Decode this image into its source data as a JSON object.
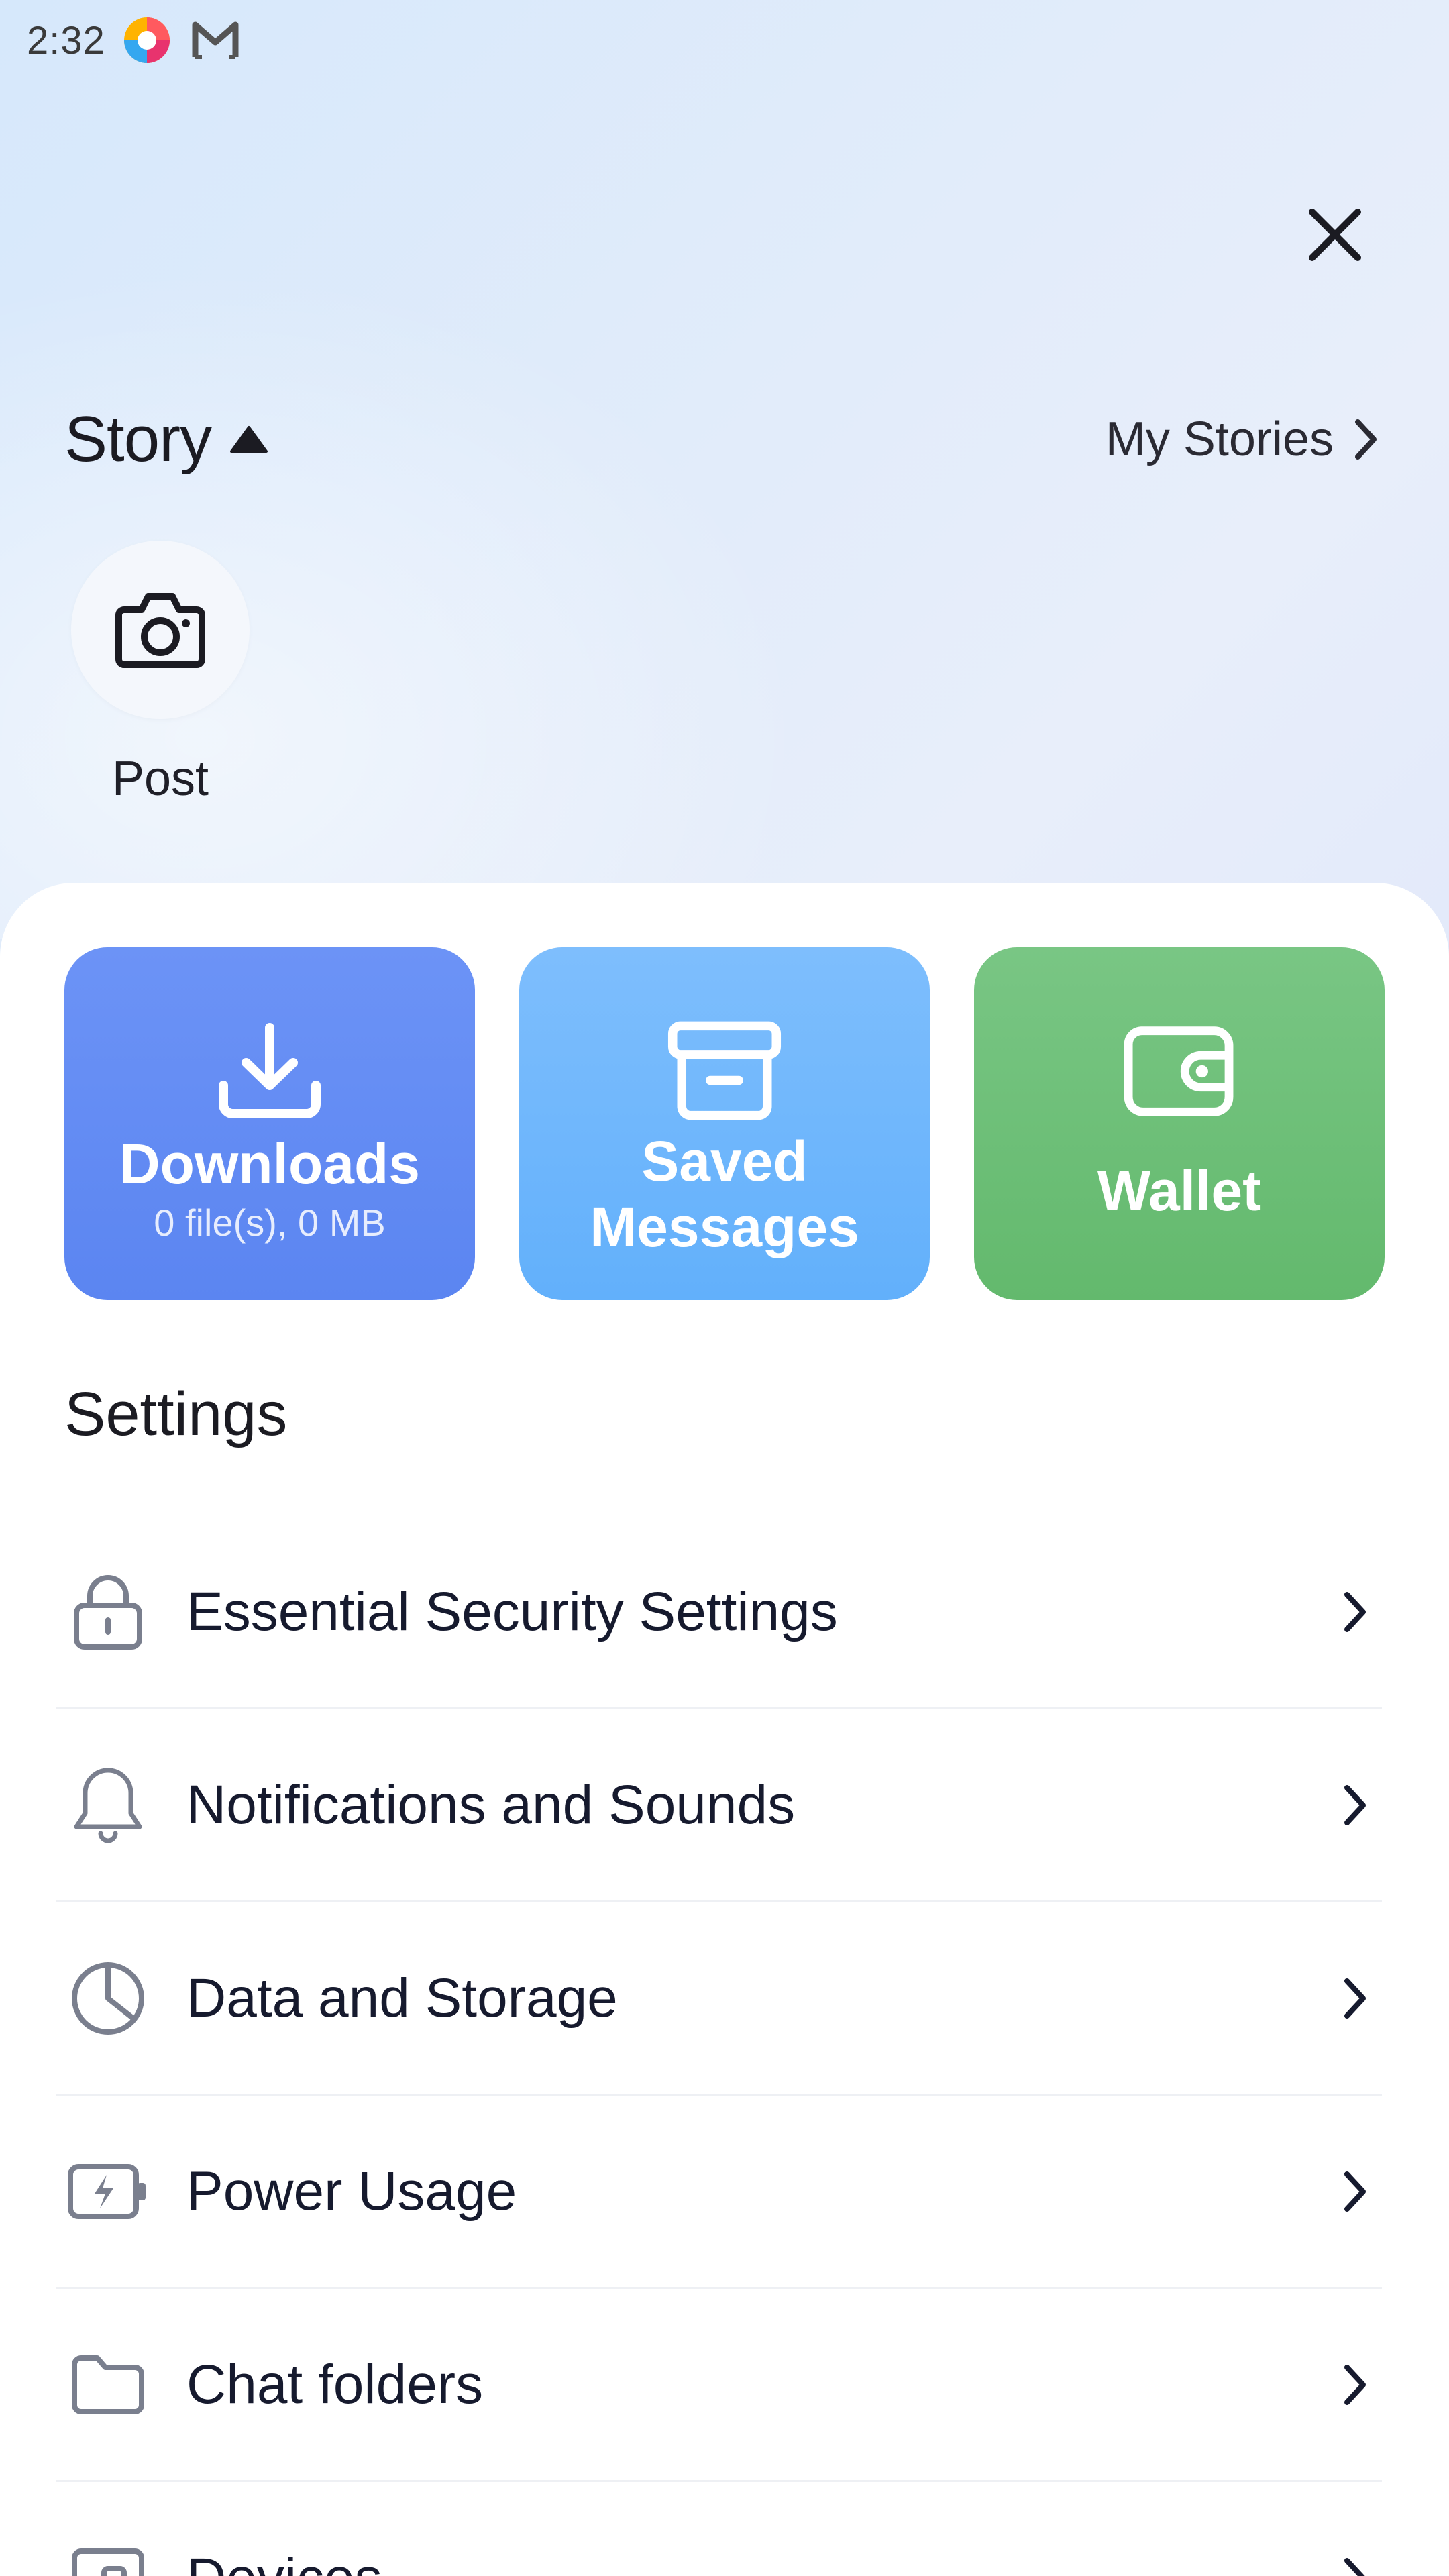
{
  "status_bar": {
    "time": "2:32",
    "icons": [
      "colorful-app-icon",
      "gmail-icon"
    ]
  },
  "header": {
    "close_icon": "close-icon"
  },
  "story": {
    "title": "Story",
    "my_stories_label": "My Stories",
    "post_label": "Post"
  },
  "tiles": [
    {
      "title": "Downloads",
      "subtitle": "0 file(s), 0 MB",
      "icon": "download-icon",
      "color": "#6189f3"
    },
    {
      "title_line1": "Saved",
      "title_line2": "Messages",
      "icon": "archive-icon",
      "color": "#6db6fc"
    },
    {
      "title": "Wallet",
      "icon": "wallet-icon",
      "color": "#6dbf78"
    }
  ],
  "settings": {
    "heading": "Settings",
    "items": [
      {
        "label": "Essential Security Settings",
        "icon": "lock-icon"
      },
      {
        "label": "Notifications and Sounds",
        "icon": "bell-icon"
      },
      {
        "label": "Data and Storage",
        "icon": "pie-chart-icon"
      },
      {
        "label": "Power Usage",
        "icon": "battery-bolt-icon"
      },
      {
        "label": "Chat folders",
        "icon": "folder-icon"
      },
      {
        "label": "Devices",
        "icon": "devices-icon"
      }
    ]
  },
  "colors": {
    "text_primary": "#161a2e",
    "icon_gray": "#7a7f8e",
    "divider": "#eef0f4"
  }
}
